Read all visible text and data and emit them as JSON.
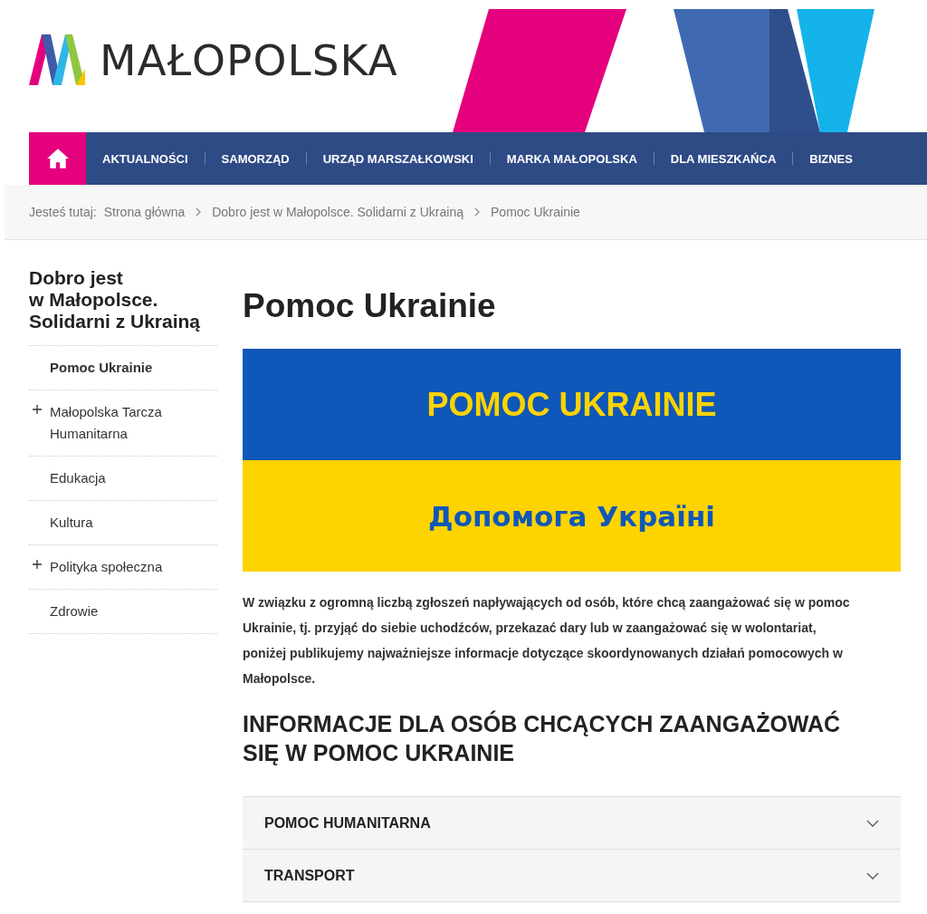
{
  "header": {
    "logo_text": "MAŁOPOLSKA"
  },
  "nav": {
    "items": [
      {
        "label": "AKTUALNOŚCI"
      },
      {
        "label": "SAMORZĄD"
      },
      {
        "label": "URZĄD MARSZAŁKOWSKI"
      },
      {
        "label": "MARKA MAŁOPOLSKA"
      },
      {
        "label": "DLA MIESZKAŃCA"
      },
      {
        "label": "BIZNES"
      }
    ]
  },
  "breadcrumb": {
    "prefix": "Jesteś tutaj:",
    "items": [
      "Strona główna",
      "Dobro jest w Małopolsce. Solidarni z Ukrainą",
      "Pomoc Ukrainie"
    ]
  },
  "sidebar": {
    "title": "Dobro jest\nw Małopolsce.\nSolidarni z Ukrainą",
    "items": [
      {
        "label": "Pomoc Ukrainie",
        "selected": true,
        "expandable": false
      },
      {
        "label": "Małopolska Tarcza Humanitarna",
        "selected": false,
        "expandable": true
      },
      {
        "label": "Edukacja",
        "selected": false,
        "expandable": false
      },
      {
        "label": "Kultura",
        "selected": false,
        "expandable": false
      },
      {
        "label": "Polityka społeczna",
        "selected": false,
        "expandable": true
      },
      {
        "label": "Zdrowie",
        "selected": false,
        "expandable": false
      }
    ]
  },
  "main": {
    "title": "Pomoc Ukrainie",
    "banner": {
      "top_text": "POMOC UKRAINIE",
      "bottom_text": "Допомога Україні"
    },
    "intro": "W związku z ogromną liczbą zgłoszeń napływających od osób, które chcą zaangażować się w pomoc Ukrainie, tj. przyjąć do siebie uchodźców, przekazać dary lub w zaangażować się w wolontariat, poniżej publikujemy najważniejsze informacje dotyczące skoordynowanych działań pomocowych w Małopolsce.",
    "section_heading": "INFORMACJE DLA OSÓB CHCĄCYCH ZAANGAŻOWAĆ SIĘ W POMOC UKRAINIE",
    "accordion": [
      {
        "label": "POMOC HUMANITARNA",
        "expanded": false
      },
      {
        "label": "TRANSPORT",
        "expanded": false
      }
    ]
  }
}
